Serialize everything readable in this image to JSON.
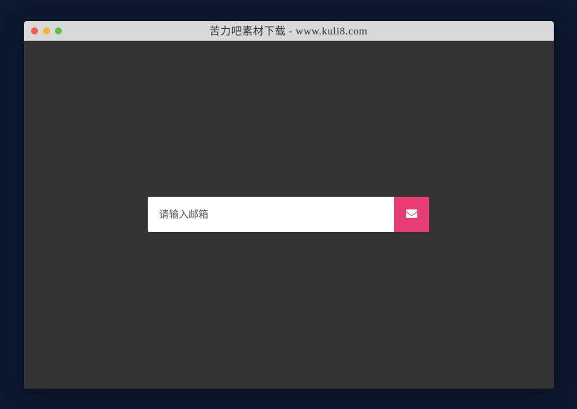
{
  "window": {
    "title": "苦力吧素材下载 - www.kuli8.com"
  },
  "form": {
    "email_placeholder": "请输入邮箱"
  },
  "colors": {
    "accent": "#e83e75",
    "background": "#333333",
    "page": "#0d1830"
  }
}
